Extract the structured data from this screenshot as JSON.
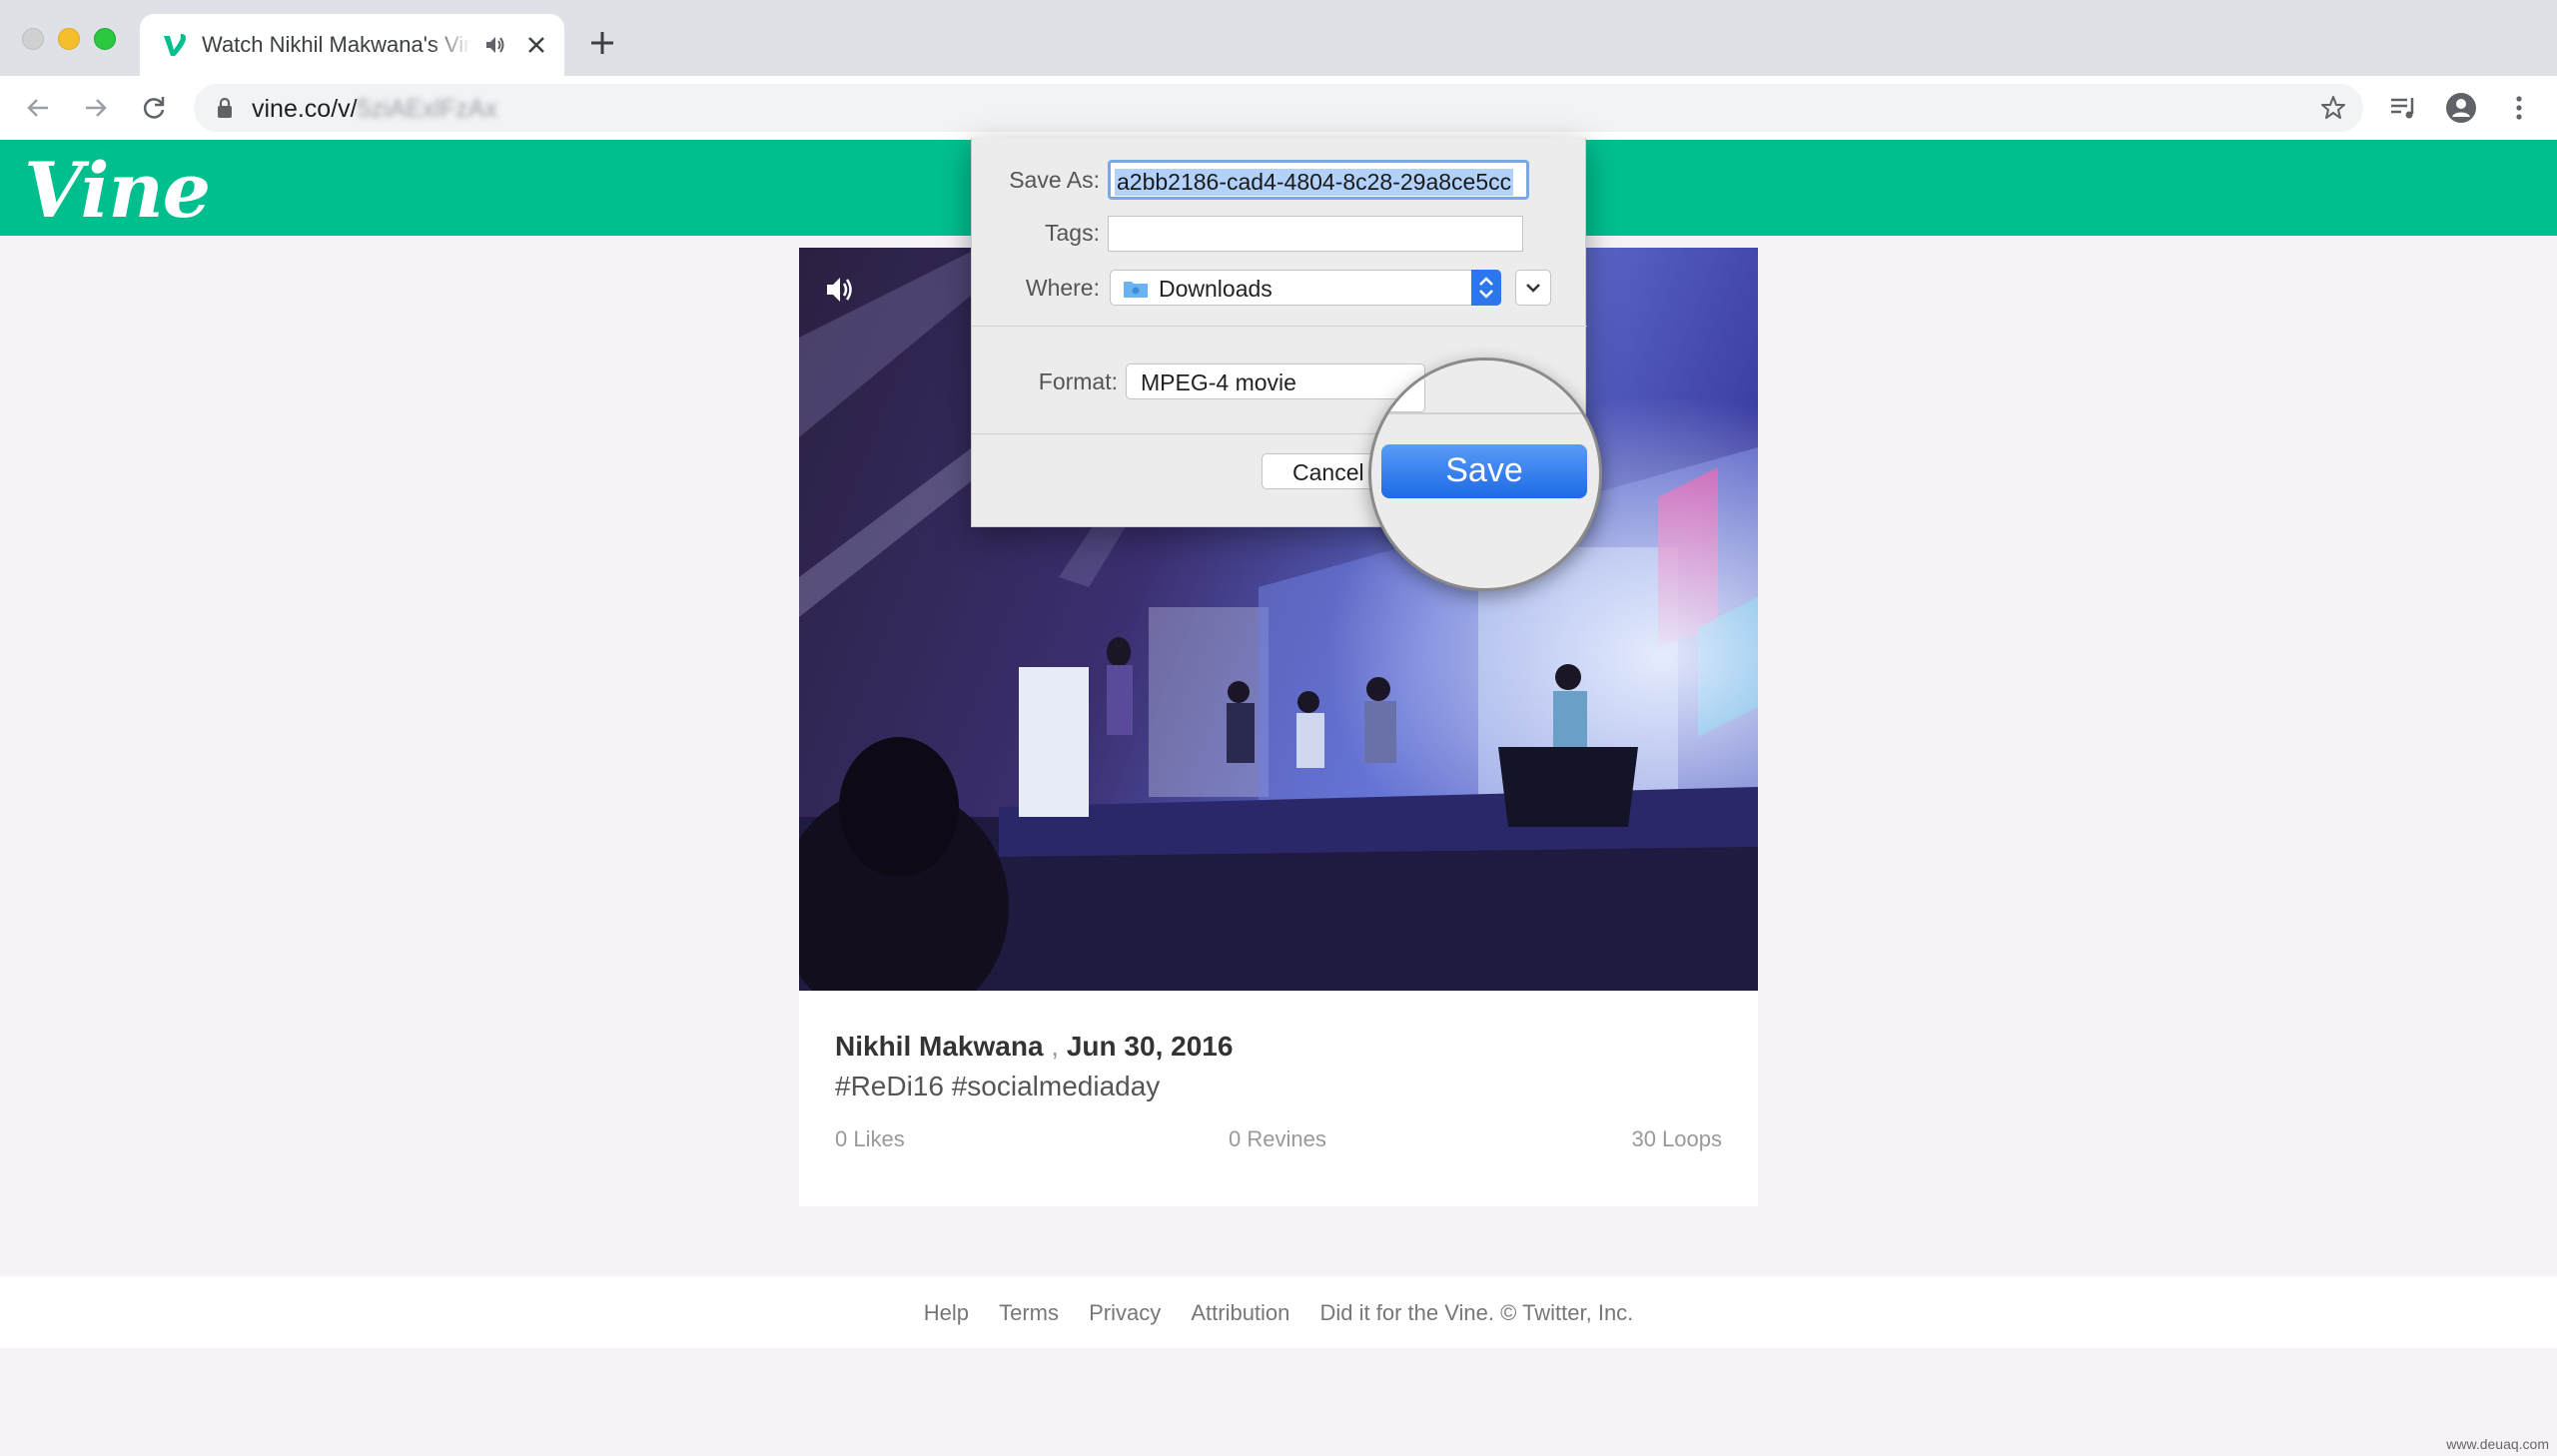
{
  "browser": {
    "tab_title": "Watch Nikhil Makwana's Vine",
    "url_prefix": "vine.co/v/",
    "url_blurred": "5ziAExlFzAx"
  },
  "site": {
    "logo": "Vine"
  },
  "post": {
    "author": "Nikhil Makwana",
    "separator": " , ",
    "date": "Jun 30, 2016",
    "tags": "#ReDi16 #socialmediaday",
    "likes": "0 Likes",
    "revines": "0 Revines",
    "loops": "30 Loops"
  },
  "footer": {
    "links": [
      "Help",
      "Terms",
      "Privacy",
      "Attribution",
      "Did it for the Vine. © Twitter, Inc."
    ]
  },
  "dialog": {
    "save_as_label": "Save As:",
    "save_as_value": "a2bb2186-cad4-4804-8c28-29a8ce5cc",
    "tags_label": "Tags:",
    "where_label": "Where:",
    "where_value": "Downloads",
    "format_label": "Format:",
    "format_value": "MPEG-4 movie",
    "cancel_label": "Cancel",
    "save_label": "Save"
  },
  "watermark": "www.deuaq.com",
  "colors": {
    "vine_green": "#00bf8f",
    "save_blue": "#1d6ae5",
    "page_bg": "#f6f3f8"
  },
  "icons": [
    "vine-favicon-icon",
    "speaker-icon",
    "close-icon",
    "plus-icon",
    "back-arrow-icon",
    "forward-arrow-icon",
    "reload-icon",
    "lock-icon",
    "star-icon",
    "media-queue-icon",
    "account-icon",
    "more-vert-icon",
    "folder-icon",
    "chevron-down-icon"
  ]
}
